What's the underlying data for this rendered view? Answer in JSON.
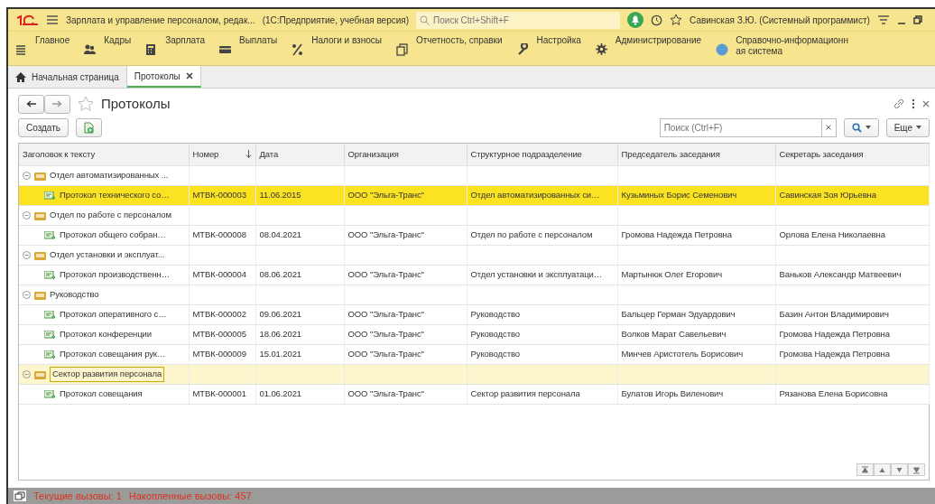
{
  "window": {
    "title": "Зарплата и управление персоналом, редак...",
    "subtitle": "(1С:Предприятие, учебная версия)",
    "search_placeholder": "Поиск Ctrl+Shift+F",
    "user": "Савинская З.Ю. (Системный программист)"
  },
  "sections": [
    {
      "label": "Главное"
    },
    {
      "label": "Кадры"
    },
    {
      "label": "Зарплата"
    },
    {
      "label": "Выплаты"
    },
    {
      "label": "Налоги и взносы"
    },
    {
      "label": "Отчетность, справки"
    },
    {
      "label": "Настройка"
    },
    {
      "label": "Администрирование"
    },
    {
      "label": "Справочно-информационная система"
    }
  ],
  "tabs": [
    {
      "label": "Начальная страница",
      "selected": false,
      "closable": false
    },
    {
      "label": "Протоколы",
      "selected": true,
      "closable": true
    }
  ],
  "form": {
    "title": "Протоколы",
    "create_button": "Создать",
    "search_placeholder": "Поиск (Ctrl+F)",
    "more_button": "Еще"
  },
  "table": {
    "columns": [
      {
        "label": "Заголовок к тексту",
        "sorted": false
      },
      {
        "label": "Номер",
        "sorted": true
      },
      {
        "label": "Дата",
        "sorted": false
      },
      {
        "label": "Организация",
        "sorted": false
      },
      {
        "label": "Структурное подразделение",
        "sorted": false
      },
      {
        "label": "Председатель заседания",
        "sorted": false
      },
      {
        "label": "Секретарь заседания",
        "sorted": false
      }
    ],
    "groups": [
      {
        "label": "Отдел автоматизированных ...",
        "expanded": true,
        "selected": false,
        "rows": [
          {
            "cells": [
              "Протокол технического со…",
              "МТВК-000003",
              "11.06.2015",
              "ООО \"Эльга-Транс\"",
              "Отдел автоматизированных си…",
              "Кузьминых Борис Семенович",
              "Савинская Зоя Юрьевна"
            ],
            "selected": true
          }
        ]
      },
      {
        "label": "Отдел по работе с персоналом",
        "expanded": true,
        "selected": false,
        "rows": [
          {
            "cells": [
              "Протокол общего собран…",
              "МТВК-000008",
              "08.04.2021",
              "ООО \"Эльга-Транс\"",
              "Отдел по работе с персоналом",
              "Громова Надежда Петровна",
              "Орлова Елена Николаевна"
            ],
            "selected": false
          }
        ]
      },
      {
        "label": "Отдел установки и эксплуат...",
        "expanded": true,
        "selected": false,
        "rows": [
          {
            "cells": [
              "Протокол производственн…",
              "МТВК-000004",
              "08.06.2021",
              "ООО \"Эльга-Транс\"",
              "Отдел установки и эксплуатаци…",
              "Мартынюк Олег Егорович",
              "Ваньков Александр Матвеевич"
            ],
            "selected": false
          }
        ]
      },
      {
        "label": "Руководство",
        "expanded": true,
        "selected": false,
        "rows": [
          {
            "cells": [
              "Протокол оперативного с…",
              "МТВК-000002",
              "09.06.2021",
              "ООО \"Эльга-Транс\"",
              "Руководство",
              "Бальцер Герман Эдуардович",
              "Базин Антон Владимирович"
            ],
            "selected": false
          },
          {
            "cells": [
              "Протокол конференции",
              "МТВК-000005",
              "18.06.2021",
              "ООО \"Эльга-Транс\"",
              "Руководство",
              "Волков Марат Савельевич",
              "Громова Надежда Петровна"
            ],
            "selected": false
          },
          {
            "cells": [
              "Протокол совещания рук…",
              "МТВК-000009",
              "15.01.2021",
              "ООО \"Эльга-Транс\"",
              "Руководство",
              "Минчев Аристотель Борисович",
              "Громова Надежда Петровна"
            ],
            "selected": false
          }
        ]
      },
      {
        "label": "Сектор развития персонала",
        "expanded": true,
        "selected": true,
        "rows": [
          {
            "cells": [
              "Протокол совещания",
              "МТВК-000001",
              "01.06.2021",
              "ООО \"Эльга-Транс\"",
              "Сектор развития персонала",
              "Булатов Игорь Виленович",
              "Рязанова Елена Борисовна"
            ],
            "selected": false
          }
        ]
      }
    ]
  },
  "status_bar": {
    "current_calls": "Текущие вызовы: 1",
    "total_calls": "Накопленные вызовы: 457"
  }
}
